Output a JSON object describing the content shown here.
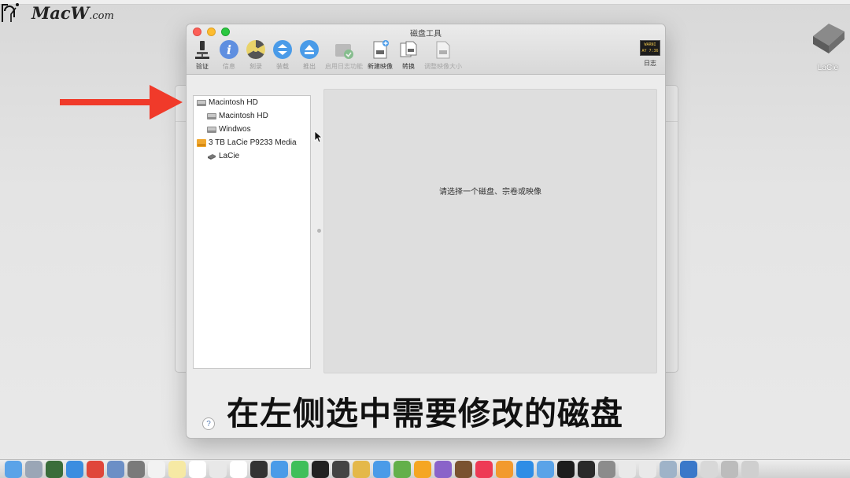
{
  "brand": {
    "name": "MacW",
    "suffix": ".com"
  },
  "window": {
    "title": "磁盘工具",
    "toolbar": [
      {
        "label": "验证",
        "icon": "microscope-icon",
        "enabled": true
      },
      {
        "label": "信息",
        "icon": "info-icon",
        "enabled": true
      },
      {
        "label": "刻录",
        "icon": "burn-icon",
        "enabled": true
      },
      {
        "label": "装载",
        "icon": "mount-icon",
        "enabled": true
      },
      {
        "label": "推出",
        "icon": "eject-icon",
        "enabled": true
      },
      {
        "label": "启用日志功能",
        "icon": "journal-icon",
        "enabled": false
      },
      {
        "label": "新建映像",
        "icon": "new-image-icon",
        "enabled": true
      },
      {
        "label": "转换",
        "icon": "convert-icon",
        "enabled": true
      },
      {
        "label": "调整映像大小",
        "icon": "resize-image-icon",
        "enabled": false
      }
    ],
    "log_label": "日志",
    "log_screen_text": "WARNI\nAY 7:36"
  },
  "sidebar": {
    "items": [
      {
        "label": "Macintosh HD",
        "level": 0,
        "icon": "internal-disk-icon"
      },
      {
        "label": "Macintosh HD",
        "level": 1,
        "icon": "volume-icon"
      },
      {
        "label": "Windwos",
        "level": 1,
        "icon": "volume-icon"
      },
      {
        "label": "3 TB LaCie P9233 Media",
        "level": 0,
        "icon": "external-disk-icon"
      },
      {
        "label": "LaCie",
        "level": 1,
        "icon": "external-volume-icon"
      }
    ]
  },
  "detail": {
    "placeholder": "请选择一个磁盘、宗卷或映像"
  },
  "help": "?",
  "desktop": {
    "drive_label": "LaCie"
  },
  "caption": "在左侧选中需要修改的磁盘",
  "colors": {
    "arrow": "#f03a2a",
    "detail_bg": "#dedede"
  }
}
